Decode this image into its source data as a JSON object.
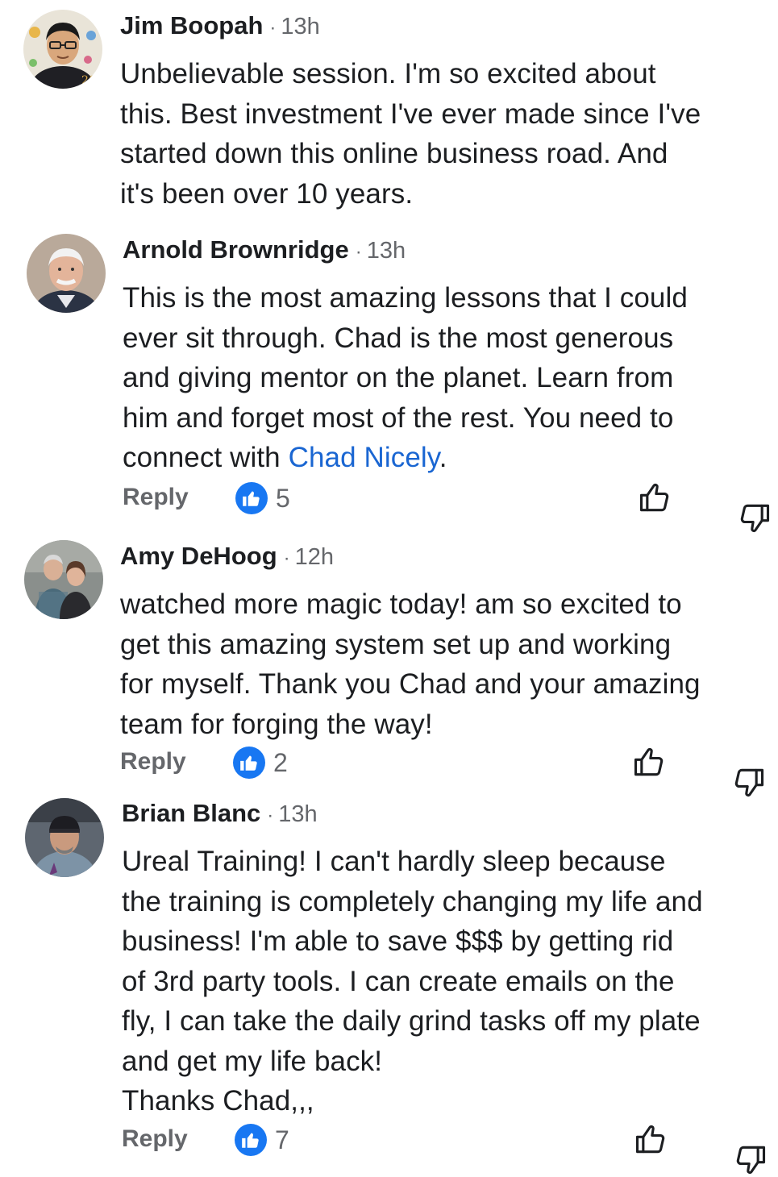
{
  "comments": [
    {
      "author": "Jim Boopah",
      "separator": "·",
      "time": "13h",
      "lines": [
        "Unbelievable session. I'm so excited about",
        "this. Best investment I've ever made since I've",
        "started down this online business road. And",
        "it's been over 10 years."
      ]
    },
    {
      "author": "Arnold Brownridge",
      "separator": "·",
      "time": "13h",
      "lines": [
        "This is the most amazing lessons that I could",
        "ever sit through. Chad is the most generous",
        "and giving mentor on the planet. Learn from",
        "him and forget most of the rest. You need to"
      ],
      "last_line_prefix": "connect with ",
      "mention": "Chad Nicely",
      "last_line_suffix": ".",
      "reply_label": "Reply",
      "like_count": "5"
    },
    {
      "author": "Amy DeHoog",
      "separator": "·",
      "time": "12h",
      "lines": [
        "watched more magic today!  am so excited to",
        "get this amazing system set up and working",
        "for myself. Thank you Chad and your amazing",
        "team for forging the way!"
      ],
      "reply_label": "Reply",
      "like_count": "2"
    },
    {
      "author": "Brian Blanc",
      "separator": "·",
      "time": "13h",
      "lines": [
        "Ureal Training! I can't hardly sleep because",
        "the training is completely changing my life and",
        "business! I'm able to save $$$ by getting rid",
        "of 3rd party tools. I can create emails on the",
        "fly, I can take the daily grind tasks off my plate",
        "and get my life back!",
        "Thanks Chad,,,"
      ],
      "reply_label": "Reply",
      "like_count": "7"
    }
  ],
  "icons": {
    "like_badge": "like-icon",
    "upvote": "thumbs-up-outline-icon",
    "downvote": "thumbs-down-outline-icon"
  },
  "colors": {
    "link": "#1a66d2",
    "like_badge": "#1877f2",
    "secondary_text": "#65676b",
    "primary_text": "#1c1e21"
  }
}
